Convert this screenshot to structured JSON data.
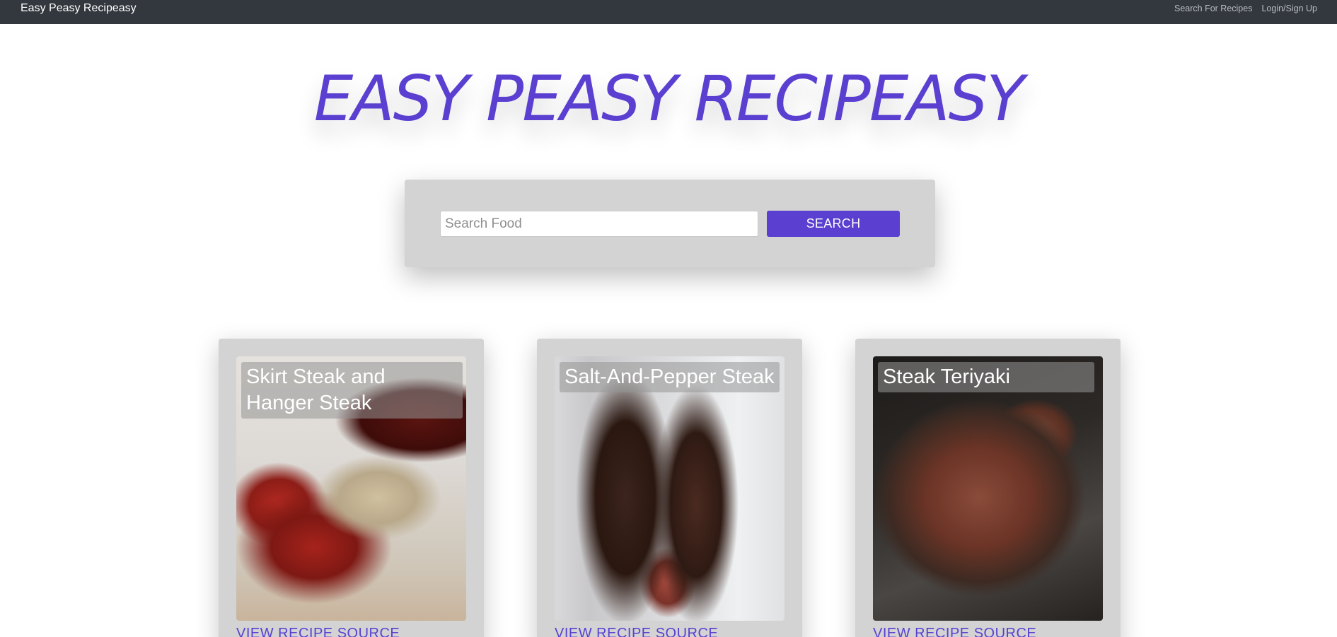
{
  "navbar": {
    "brand": "Easy Peasy Recipeasy",
    "links": [
      "Search For Recipes",
      "Login/Sign Up"
    ]
  },
  "hero": {
    "title": "EASY PEASY RECIPEASY"
  },
  "search": {
    "placeholder": "Search Food",
    "value": "",
    "button_label": "SEARCH"
  },
  "cards": [
    {
      "title": "Skirt Steak and Hanger Steak",
      "link_label": "VIEW RECIPE SOURCE"
    },
    {
      "title": "Salt-And-Pepper Steak",
      "link_label": "VIEW RECIPE SOURCE"
    },
    {
      "title": "Steak Teriyaki",
      "link_label": "VIEW RECIPE SOURCE"
    }
  ],
  "colors": {
    "accent": "#5a3fd1",
    "navbar_bg": "#33373e",
    "panel_bg": "#d3d3d3"
  }
}
